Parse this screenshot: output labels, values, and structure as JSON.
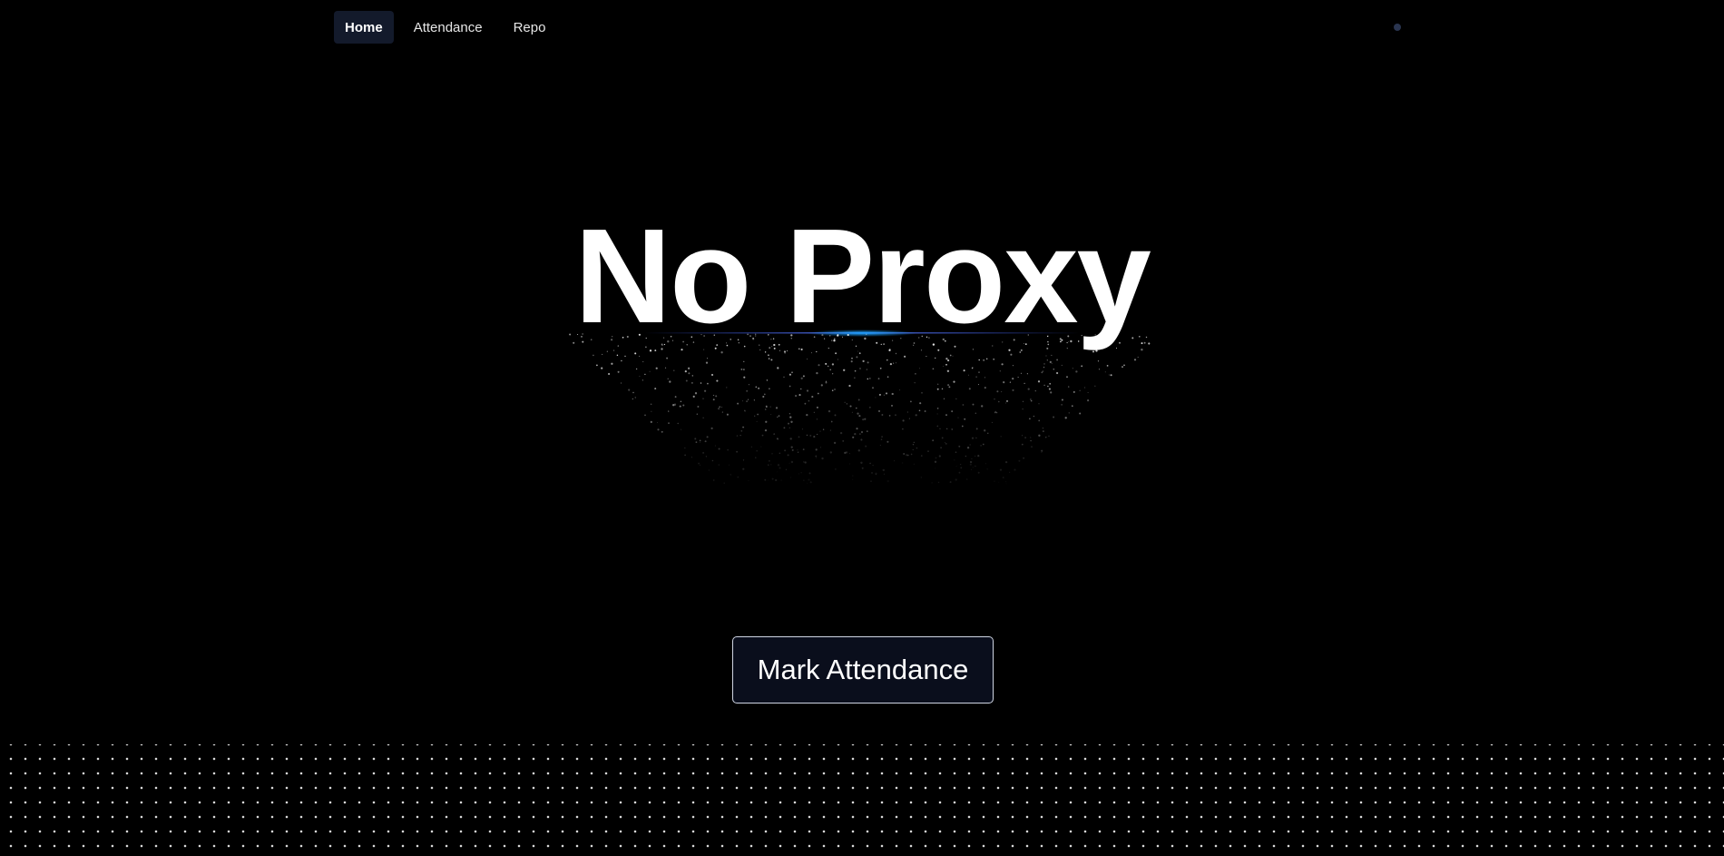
{
  "nav": {
    "items": [
      {
        "label": "Home",
        "active": true
      },
      {
        "label": "Attendance",
        "active": false
      },
      {
        "label": "Repo",
        "active": false
      }
    ]
  },
  "hero": {
    "title": "No Proxy"
  },
  "cta": {
    "label": "Mark Attendance"
  },
  "colors": {
    "background": "#000000",
    "nav_active_bg": "#131a2b",
    "accent_glow": "#1ea0ff",
    "button_bg": "#0a0e1c",
    "button_border": "#cfd5e3"
  }
}
